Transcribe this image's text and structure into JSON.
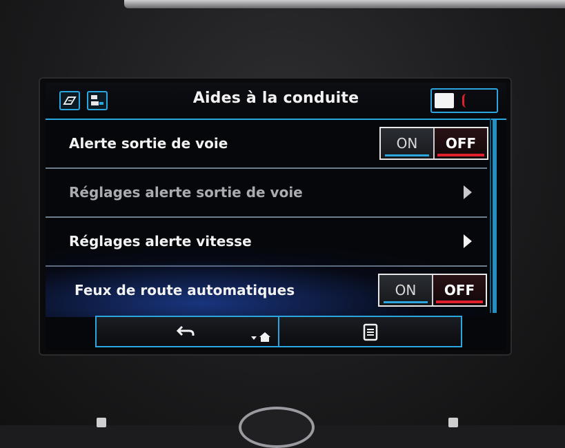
{
  "header": {
    "title": "Aides à la conduite",
    "left_icons": [
      "road-sign-icon",
      "lane-display-icon"
    ],
    "right_icons": [
      "note-icon",
      "status-red-icon"
    ]
  },
  "rows": [
    {
      "label": "Alerte sortie de voie",
      "type": "toggle",
      "on_label": "ON",
      "off_label": "OFF",
      "selected": "OFF",
      "dimmed": false
    },
    {
      "label": "Réglages alerte sortie de voie",
      "type": "submenu",
      "dimmed": true
    },
    {
      "label": "Réglages alerte vitesse",
      "type": "submenu",
      "dimmed": false
    },
    {
      "label": "Feux de route automatiques",
      "type": "toggle",
      "on_label": "ON",
      "off_label": "OFF",
      "selected": "OFF",
      "dimmed": false
    }
  ],
  "bottom_bar": {
    "buttons": [
      "back-icon",
      "home-dropdown-icon",
      "list-menu-icon"
    ]
  },
  "colors": {
    "accent": "#2aa7e0",
    "off_indicator": "#e0202a",
    "background": "#06070b"
  }
}
